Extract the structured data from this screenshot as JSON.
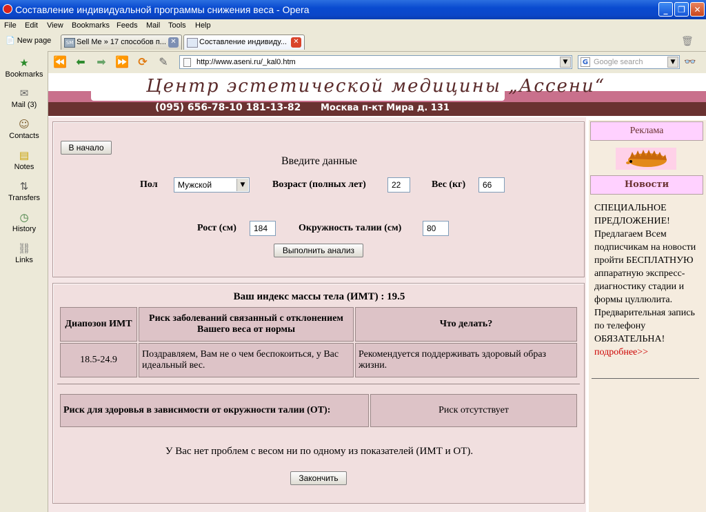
{
  "window": {
    "title": "Составление индивидуальной программы снижения веса - Opera"
  },
  "menu": [
    "File",
    "Edit",
    "View",
    "Bookmarks",
    "Feeds",
    "Mail",
    "Tools",
    "Help"
  ],
  "tabs": {
    "new_page": "New page",
    "items": [
      {
        "label": "Sell Me » 17 способов п..."
      },
      {
        "label": "Составление индивиду..."
      }
    ]
  },
  "toolbar": {
    "address": "http://www.aseni.ru/_kal0.htm",
    "search_placeholder": "Google search"
  },
  "sidebar": {
    "items": [
      "Bookmarks",
      "Mail (3)",
      "Contacts",
      "Notes",
      "Transfers",
      "History",
      "Links"
    ]
  },
  "banner": {
    "title": "Центр эстетической медицины „Ассени“",
    "phone": "(095) 656-78-10   181-13-82",
    "address": "Москва п-кт Мира д. 131"
  },
  "form": {
    "back_button": "В начало",
    "heading": "Введите данные",
    "sex_label": "Пол",
    "sex_value": "Мужской",
    "age_label": "Возраст (полных лет)",
    "age_value": "22",
    "weight_label": "Вес (кг)",
    "weight_value": "66",
    "height_label": "Рост (см)",
    "height_value": "184",
    "waist_label": "Окружность талии (см)",
    "waist_value": "80",
    "submit_button": "Выполнить анализ"
  },
  "result": {
    "bmi_title": "Ваш индекс массы тела (ИМТ) : 19.5",
    "headers": [
      "Диапозон ИМТ",
      "Риск заболеваний связанный с отклонением Вашего веса от нормы",
      "Что делать?"
    ],
    "row": [
      "18.5-24.9",
      "Поздравляем, Вам не о чем беспокоиться, у Вас идеальный вес.",
      "Рекомендуется поддерживать здоровый образ жизни."
    ],
    "waist_risk_label": "Риск для здоровья в зависимости от окружности талии (ОТ):",
    "waist_risk_value": "Риск отсутствует",
    "summary": "У Вас нет проблем с весом ни по одному из показателей (ИМТ и ОТ).",
    "finish_button": "Закончить"
  },
  "right": {
    "ad_label": "Реклама",
    "news_label": "Новости",
    "news_text": "СПЕЦИАЛЬНОЕ ПРЕДЛОЖЕНИЕ! Предлагаем Всем подписчикам на новости пройти БЕСПЛАТНУЮ аппаратную экспресс-диагностику стадии и формы цуллюлита. Предварительная запись по телефону ОБЯЗАТЕЛЬНА!",
    "more_link": "подробнее>>"
  },
  "colors": {
    "titlebar": "#0a4bd0",
    "banner_brown": "#6a3231",
    "banner_pink": "#c9708c",
    "cell_bg": "#ddc3c7",
    "link_red": "#cc0000"
  }
}
